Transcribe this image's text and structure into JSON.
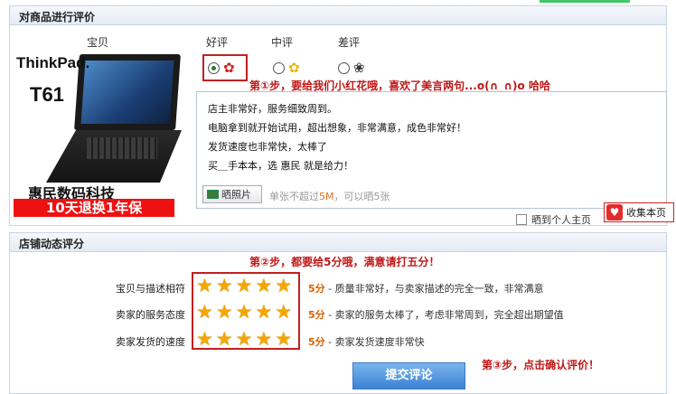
{
  "review_section": {
    "title": "对商品进行评价",
    "columns": {
      "item": "宝贝",
      "good": "好评",
      "neutral": "中评",
      "bad": "差评"
    },
    "product": {
      "brand": "ThinkPad.",
      "model": "T61",
      "shop_name": "惠民数码科技",
      "tagline": "10天退换1年保"
    },
    "selected_rating": "好评",
    "step1": "第①步，要给我们小红花哦，喜欢了美言两句...o(∩_∩)o 哈哈",
    "review_lines": [
      "店主非常好，服务细致周到。",
      "电脑拿到就开始试用，超出想象，非常满意，成色非常好！",
      "发货速度也非常快，太棒了",
      "买＿手本本，选 惠民 就是给力！"
    ],
    "photo_button": "晒照片",
    "photo_hint_prefix": "单张不超过",
    "photo_hint_size": "5M",
    "photo_hint_suffix": "，可以晒5张",
    "share_label": "晒到个人主页",
    "collect_label": "收集本页"
  },
  "shop_section": {
    "title": "店铺动态评分",
    "step2": "第②步，都要给5分哦，满意请打五分！",
    "scores": [
      {
        "label": "宝贝与描述相符",
        "stars": 5,
        "score": "5分",
        "desc": " - 质量非常好，与卖家描述的完全一致，非常满意"
      },
      {
        "label": "卖家的服务态度",
        "stars": 5,
        "score": "5分",
        "desc": " - 卖家的服务太棒了，考虑非常周到，完全超出期望值"
      },
      {
        "label": "卖家发货的速度",
        "stars": 5,
        "score": "5分",
        "desc": " - 卖家发货速度非常快"
      }
    ],
    "step3": "第③步，点击确认评价！",
    "submit_label": "提交评论"
  },
  "colors": {
    "accent_red": "#c01818",
    "star": "#f5a700",
    "submit_blue": "#3b83d4"
  },
  "icons": [
    "flower-icon",
    "star-icon",
    "photo-icon",
    "heart-icon"
  ]
}
